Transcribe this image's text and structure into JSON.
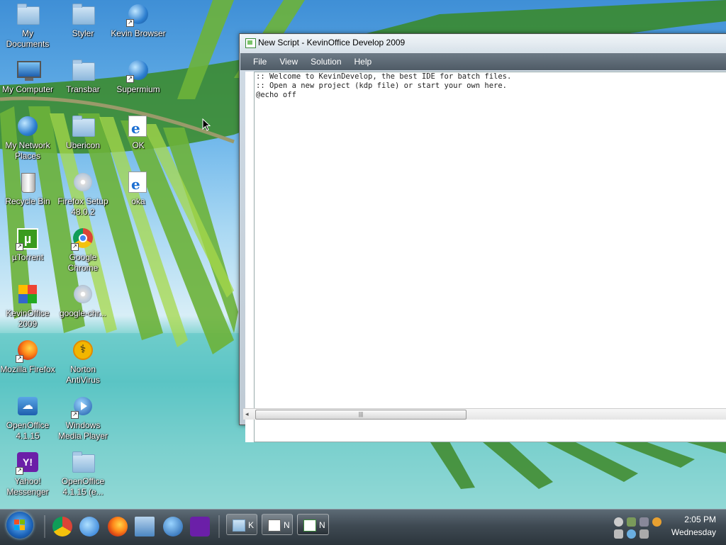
{
  "desktop": {
    "icons": [
      {
        "label": "My Documents",
        "icon": "folder-icon"
      },
      {
        "label": "Styler",
        "icon": "folder-icon"
      },
      {
        "label": "Kevin Browser",
        "icon": "globe-icon"
      },
      {
        "label": "My Computer",
        "icon": "computer-icon"
      },
      {
        "label": "Transbar",
        "icon": "folder-icon"
      },
      {
        "label": "Supermium",
        "icon": "globe-icon"
      },
      {
        "label": "My Network Places",
        "icon": "network-globe-icon"
      },
      {
        "label": "Ubericon",
        "icon": "folder-icon"
      },
      {
        "label": "OK",
        "icon": "ie-document-icon"
      },
      {
        "label": "Recycle Bin",
        "icon": "recycle-bin-icon"
      },
      {
        "label": "Firefox Setup 48.0.2",
        "icon": "installer-icon"
      },
      {
        "label": "oka",
        "icon": "ie-document-icon"
      },
      {
        "label": "µTorrent",
        "icon": "utorrent-icon"
      },
      {
        "label": "Google Chrome",
        "icon": "chrome-icon"
      },
      {
        "label": "KevinOffice 2009",
        "icon": "office-icon"
      },
      {
        "label": "google-chr...",
        "icon": "installer-disc-icon"
      },
      {
        "label": "Mozilla Firefox",
        "icon": "firefox-icon"
      },
      {
        "label": "Norton AntiVirus",
        "icon": "norton-icon"
      },
      {
        "label": "OpenOffice 4.1.15",
        "icon": "openoffice-icon"
      },
      {
        "label": "Windows Media Player",
        "icon": "media-player-icon"
      },
      {
        "label": "Yahoo! Messenger",
        "icon": "yahoo-messenger-icon"
      },
      {
        "label": "OpenOffice 4.1.15 (e...",
        "icon": "folder-icon"
      }
    ]
  },
  "window": {
    "title": "New Script - KevinOffice Develop 2009",
    "menu": [
      "File",
      "View",
      "Solution",
      "Help"
    ],
    "editor_lines": [
      ":: Welcome to KevinDevelop, the best IDE for batch files.",
      ":: Open a new project (kdp file) or start your own here.",
      "@echo off"
    ]
  },
  "taskbar": {
    "buttons": [
      {
        "label": "K"
      },
      {
        "label": "N"
      },
      {
        "label": "N"
      }
    ],
    "clock_time": "2:05 PM",
    "clock_day": "Wednesday"
  },
  "colors": {
    "accent": "#1b62b8",
    "menubar": "#5a6671",
    "taskbar": "#3f4a53"
  }
}
